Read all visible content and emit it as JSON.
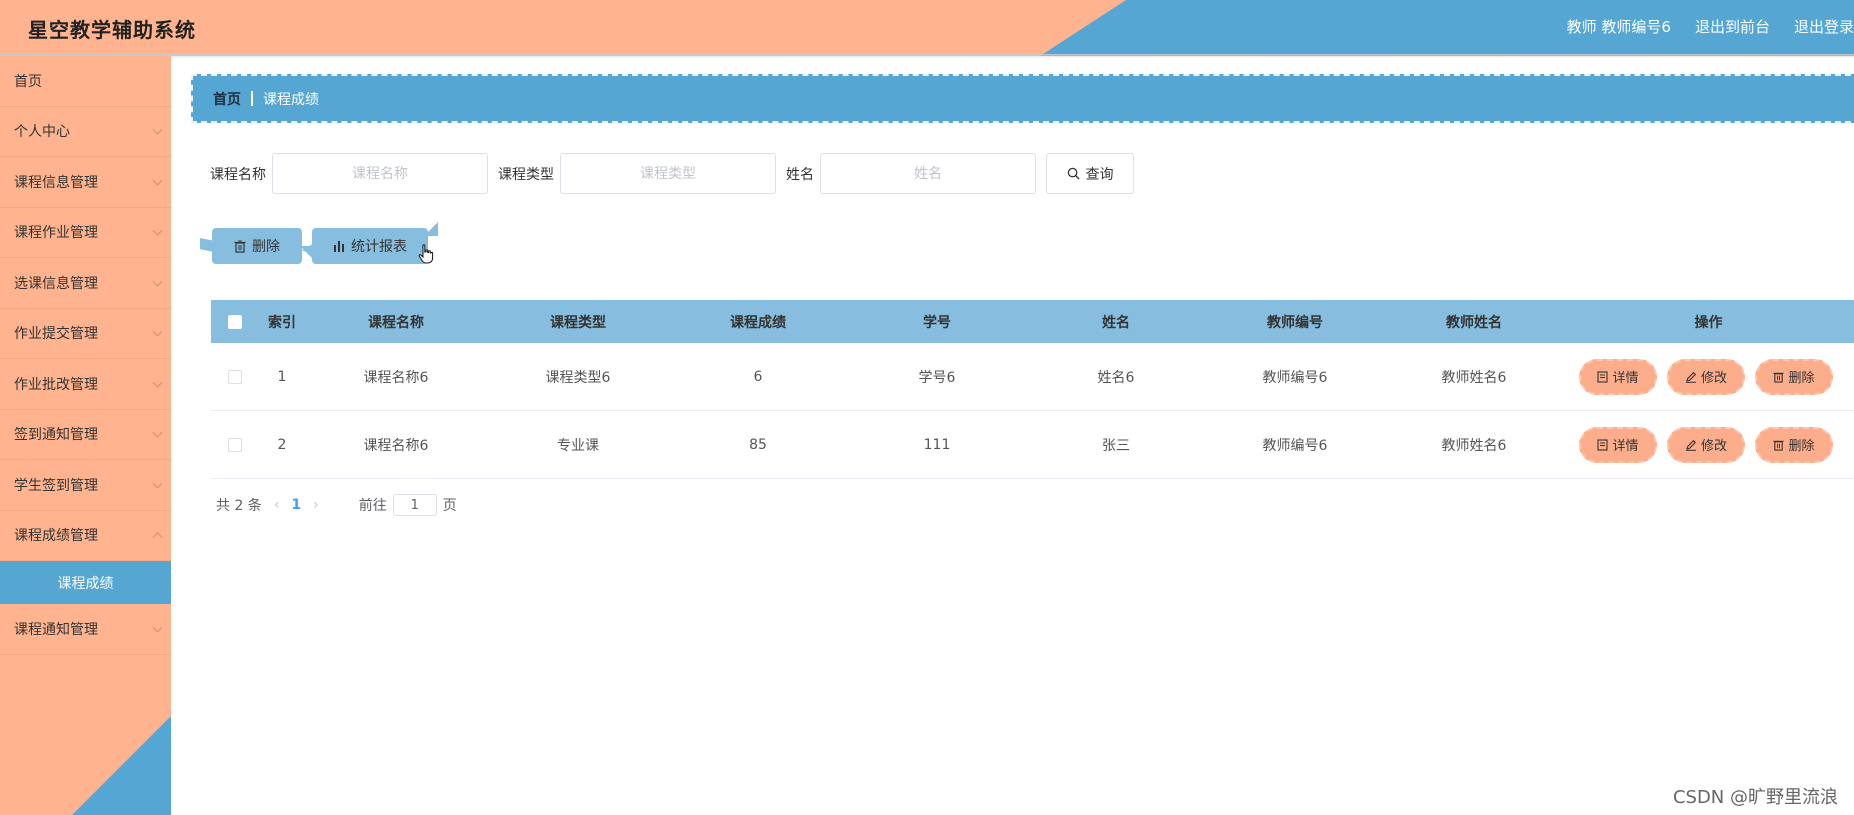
{
  "app": {
    "title": "星空教学辅助系统"
  },
  "header": {
    "user": "教师 教师编号6",
    "back_to_front": "退出到前台",
    "logout": "退出登录"
  },
  "sidebar": {
    "items": [
      {
        "label": "首页"
      },
      {
        "label": "个人中心"
      },
      {
        "label": "课程信息管理"
      },
      {
        "label": "课程作业管理"
      },
      {
        "label": "选课信息管理"
      },
      {
        "label": "作业提交管理"
      },
      {
        "label": "作业批改管理"
      },
      {
        "label": "签到通知管理"
      },
      {
        "label": "学生签到管理"
      },
      {
        "label": "课程成绩管理"
      },
      {
        "label": "课程通知管理"
      }
    ],
    "sub_active": "课程成绩"
  },
  "breadcrumb": {
    "home": "首页",
    "current": "课程成绩"
  },
  "search": {
    "course_name_label": "课程名称",
    "course_name_placeholder": "课程名称",
    "course_type_label": "课程类型",
    "course_type_placeholder": "课程类型",
    "name_label": "姓名",
    "name_placeholder": "姓名",
    "query_button": "查询"
  },
  "actions": {
    "delete": "删除",
    "stats": "统计报表"
  },
  "table": {
    "headers": {
      "index": "索引",
      "course_name": "课程名称",
      "course_type": "课程类型",
      "score": "课程成绩",
      "student_no": "学号",
      "name": "姓名",
      "teacher_no": "教师编号",
      "teacher_name": "教师姓名",
      "ops": "操作"
    },
    "rows": [
      {
        "index": "1",
        "course_name": "课程名称6",
        "course_type": "课程类型6",
        "score": "6",
        "student_no": "学号6",
        "name": "姓名6",
        "teacher_no": "教师编号6",
        "teacher_name": "教师姓名6"
      },
      {
        "index": "2",
        "course_name": "课程名称6",
        "course_type": "专业课",
        "score": "85",
        "student_no": "111",
        "name": "张三",
        "teacher_no": "教师编号6",
        "teacher_name": "教师姓名6"
      }
    ],
    "op_labels": {
      "detail": "详情",
      "edit": "修改",
      "delete": "删除"
    }
  },
  "pagination": {
    "total": "共 2 条",
    "current_page": "1",
    "goto_prefix": "前往",
    "goto_value": "1",
    "goto_suffix": "页"
  },
  "watermark": "CSDN @旷野里流浪",
  "colors": {
    "peach": "#ffb48f",
    "blue": "#56a6d4",
    "light_blue": "#87bedf",
    "op_button": "#fcad8b"
  }
}
